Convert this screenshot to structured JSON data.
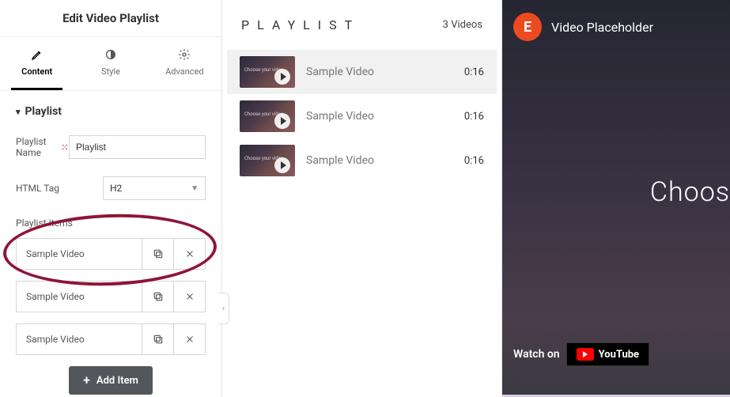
{
  "sidebar": {
    "title": "Edit Video Playlist",
    "tabs": {
      "content": "Content",
      "style": "Style",
      "advanced": "Advanced"
    },
    "section": {
      "heading": "Playlist",
      "nameLabel": "Playlist Name",
      "nameValue": "Playlist",
      "tagLabel": "HTML Tag",
      "tagValue": "H2",
      "itemsLabel": "Playlist Items",
      "items": [
        {
          "title": "Sample Video"
        },
        {
          "title": "Sample Video"
        },
        {
          "title": "Sample Video"
        }
      ],
      "addItem": "Add Item"
    }
  },
  "center": {
    "title": "PLAYLIST",
    "count": "3 Videos",
    "rows": [
      {
        "title": "Sample Video",
        "duration": "0:16"
      },
      {
        "title": "Sample Video",
        "duration": "0:16"
      },
      {
        "title": "Sample Video",
        "duration": "0:16"
      }
    ],
    "thumbLabel": "Choose your video"
  },
  "video": {
    "title": "Video Placeholder",
    "centerText": "Choos",
    "watchOn": "Watch on",
    "youtube": "YouTube",
    "logo": "E"
  }
}
